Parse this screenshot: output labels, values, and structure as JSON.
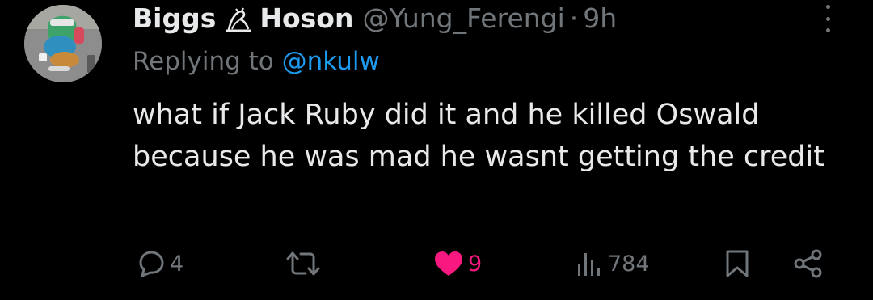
{
  "tweet": {
    "display_name_first": "Biggs",
    "display_name_last": "Hoson",
    "handle": "@Yung_Ferengi",
    "separator": "·",
    "time": "9h",
    "replying_prefix": "Replying to ",
    "replying_to": "@nkulw",
    "text": "what if Jack Ruby did it and he killed Oswald because he was mad he wasnt getting the credit"
  },
  "actions": {
    "reply_count": "4",
    "retweet_count": "",
    "like_count": "9",
    "views_count": "784"
  },
  "colors": {
    "background": "#000000",
    "primary_text": "#e7e9ea",
    "secondary_text": "#71767b",
    "mention": "#1d9bf0",
    "like": "#f91880"
  },
  "icons": {
    "display_name_emoji": "owl-icon",
    "more": "more-vertical-icon",
    "reply": "reply-icon",
    "retweet": "retweet-icon",
    "like": "heart-icon",
    "views": "views-icon",
    "bookmark": "bookmark-icon",
    "share": "share-icon"
  }
}
